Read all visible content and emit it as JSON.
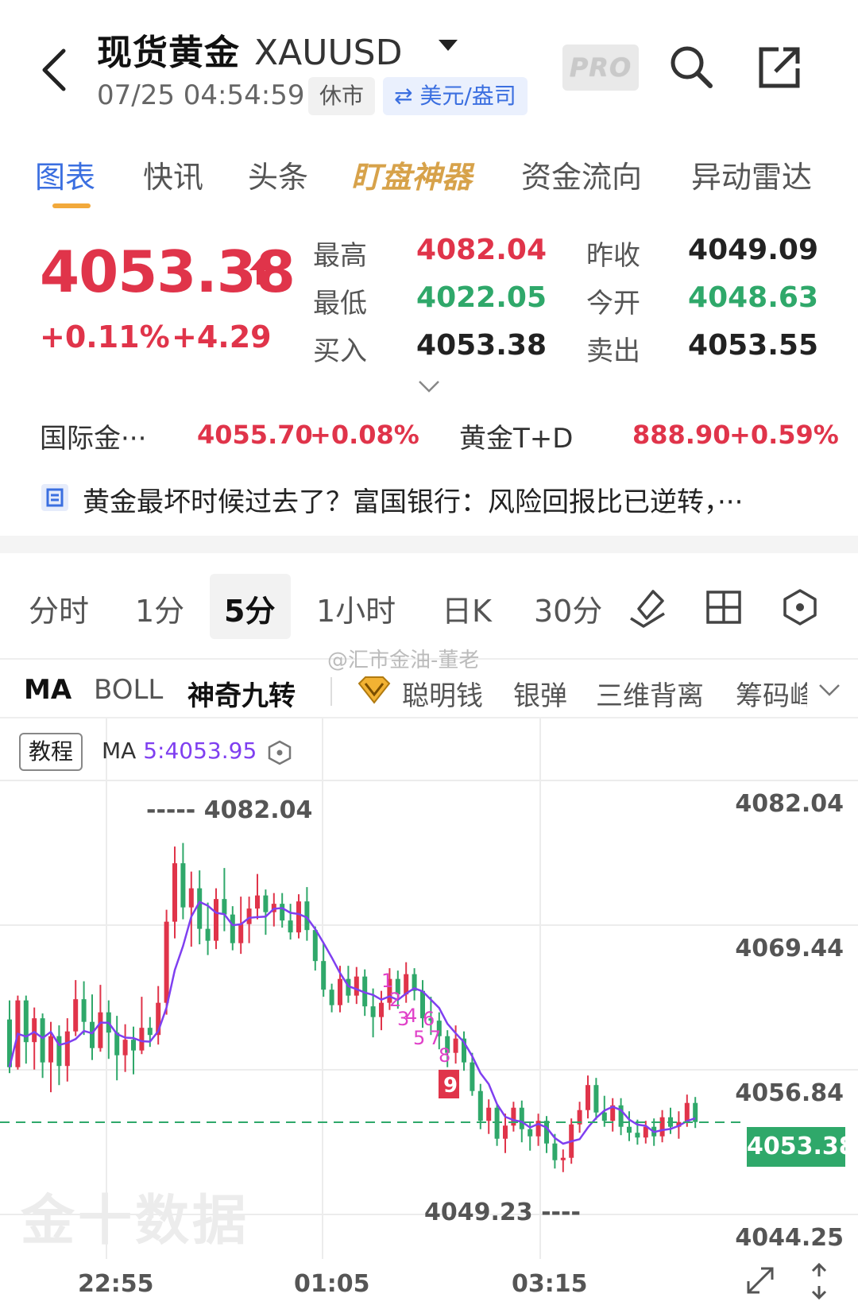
{
  "header": {
    "title": "现货黄金",
    "symbol": "XAUUSD",
    "datetime": "07/25 04:54:59",
    "market_status": "休市",
    "currency": "⇄ 美元/盎司",
    "pro_label": "PRO"
  },
  "tabs": [
    "图表",
    "快讯",
    "头条",
    "盯盘神器",
    "资金流向",
    "异动雷达"
  ],
  "quote": {
    "price": "4053.38",
    "change_pct": "+0.11%",
    "change_abs": "+4.29",
    "stats": [
      {
        "label": "最高",
        "value": "4082.04",
        "color": "red"
      },
      {
        "label": "昨收",
        "value": "4049.09",
        "color": "dark"
      },
      {
        "label": "最低",
        "value": "4022.05",
        "color": "green"
      },
      {
        "label": "今开",
        "value": "4048.63",
        "color": "green"
      },
      {
        "label": "买入",
        "value": "4053.38",
        "color": "dark"
      },
      {
        "label": "卖出",
        "value": "4053.55",
        "color": "dark"
      }
    ]
  },
  "related": [
    {
      "label": "国际金···",
      "price": "4055.70",
      "change": "+0.08%"
    },
    {
      "label": "黄金T+D",
      "price": "888.90",
      "change": "+0.59%"
    }
  ],
  "news": {
    "text": "黄金最坏时候过去了？富国银行：风险回报比已逆转，···"
  },
  "periods": [
    "分时",
    "1分",
    "5分",
    "1小时",
    "日K",
    "30分"
  ],
  "active_period": "5分",
  "indicators": {
    "main": [
      "MA",
      "BOLL",
      "神奇九转"
    ],
    "extra": [
      "聪明钱",
      "银弹",
      "三维背离",
      "筹码峰"
    ]
  },
  "watermark": "@汇市金油-董老",
  "chart": {
    "tutorial_label": "教程",
    "ma_prefix": "MA ",
    "ma_value": "5:4053.95",
    "last_price": "4053.38",
    "high_label": "4082.04",
    "low_label": "4049.23",
    "brand": "金十数据"
  },
  "chart_data": {
    "type": "candlestick",
    "title": "",
    "y_ticks": [
      "4082.04",
      "4069.44",
      "4056.84",
      "4044.25"
    ],
    "ylim": [
      4044.25,
      4082.04
    ],
    "x_ticks": [
      "22:55",
      "01:05",
      "03:15"
    ],
    "high": 4082.04,
    "low": 4049.23,
    "last": 4053.38,
    "ma5": 4053.95,
    "td_sequential_labels": [
      "1",
      "2",
      "3",
      "4",
      "6",
      "5",
      "7",
      "8",
      "9"
    ],
    "colors": {
      "up": "#e0344a",
      "down": "#2fa86a",
      "ma": "#7f3ff0",
      "td": "#e040c8"
    },
    "candles": [
      [
        4062.0,
        4063.6,
        4057.5,
        4058.0
      ],
      [
        4058.0,
        4064.0,
        4057.8,
        4063.6
      ],
      [
        4063.6,
        4064.0,
        4058.3,
        4060.1
      ],
      [
        4060.1,
        4063.0,
        4057.8,
        4062.1
      ],
      [
        4062.1,
        4062.5,
        4057.1,
        4058.4
      ],
      [
        4058.4,
        4061.8,
        4055.9,
        4060.6
      ],
      [
        4060.6,
        4061.5,
        4056.5,
        4058.1
      ],
      [
        4058.1,
        4062.1,
        4056.8,
        4061.0
      ],
      [
        4061.0,
        4065.3,
        4060.6,
        4063.7
      ],
      [
        4063.7,
        4065.2,
        4060.7,
        4061.8
      ],
      [
        4061.8,
        4064.1,
        4058.6,
        4059.6
      ],
      [
        4059.6,
        4064.9,
        4059.3,
        4062.6
      ],
      [
        4062.6,
        4063.6,
        4058.7,
        4060.9
      ],
      [
        4060.9,
        4062.3,
        4056.9,
        4059.0
      ],
      [
        4059.0,
        4061.6,
        4057.6,
        4060.3
      ],
      [
        4060.3,
        4061.4,
        4057.4,
        4059.4
      ],
      [
        4059.4,
        4063.9,
        4059.1,
        4061.3
      ],
      [
        4061.3,
        4062.2,
        4059.7,
        4060.7
      ],
      [
        4060.7,
        4064.8,
        4059.9,
        4063.4
      ],
      [
        4063.4,
        4071.2,
        4062.4,
        4070.2
      ],
      [
        4070.2,
        4076.5,
        4068.8,
        4075.1
      ],
      [
        4075.1,
        4076.8,
        4070.4,
        4071.4
      ],
      [
        4071.4,
        4074.4,
        4068.1,
        4073.0
      ],
      [
        4073.0,
        4074.5,
        4068.3,
        4069.6
      ],
      [
        4069.6,
        4071.8,
        4067.4,
        4068.6
      ],
      [
        4068.6,
        4073.0,
        4067.9,
        4072.1
      ],
      [
        4072.1,
        4074.7,
        4069.4,
        4070.8
      ],
      [
        4070.8,
        4071.5,
        4067.8,
        4068.4
      ],
      [
        4068.4,
        4072.3,
        4067.5,
        4070.0
      ],
      [
        4070.0,
        4072.3,
        4068.4,
        4071.3
      ],
      [
        4071.3,
        4074.2,
        4070.4,
        4072.4
      ],
      [
        4072.4,
        4072.9,
        4069.1,
        4071.0
      ],
      [
        4071.0,
        4072.6,
        4069.8,
        4071.7
      ],
      [
        4071.7,
        4072.6,
        4069.7,
        4070.3
      ],
      [
        4070.3,
        4071.7,
        4068.7,
        4069.3
      ],
      [
        4069.3,
        4072.5,
        4068.8,
        4071.9
      ],
      [
        4071.9,
        4073.1,
        4068.6,
        4069.5
      ],
      [
        4069.5,
        4069.8,
        4066.1,
        4066.9
      ],
      [
        4066.9,
        4068.4,
        4063.9,
        4064.5
      ],
      [
        4064.5,
        4065.0,
        4062.6,
        4063.2
      ],
      [
        4063.2,
        4066.5,
        4062.6,
        4065.4
      ],
      [
        4065.4,
        4066.5,
        4063.4,
        4064.0
      ],
      [
        4064.0,
        4066.4,
        4063.3,
        4065.6
      ],
      [
        4065.6,
        4066.2,
        4062.3,
        4063.1
      ],
      [
        4063.1,
        4064.6,
        4060.5,
        4062.2
      ],
      [
        4062.2,
        4064.4,
        4061.1,
        4063.4
      ],
      [
        4063.4,
        4066.3,
        4062.8,
        4065.4
      ],
      [
        4065.4,
        4066.1,
        4062.9,
        4064.1
      ],
      [
        4064.1,
        4066.8,
        4063.4,
        4065.8
      ],
      [
        4065.8,
        4066.3,
        4063.6,
        4064.4
      ],
      [
        4064.4,
        4065.3,
        4061.3,
        4062.1
      ],
      [
        4062.1,
        4063.9,
        4060.7,
        4061.9
      ],
      [
        4061.9,
        4062.6,
        4059.5,
        4060.6
      ],
      [
        4060.6,
        4061.1,
        4058.0,
        4059.2
      ],
      [
        4059.2,
        4061.5,
        4058.3,
        4060.4
      ],
      [
        4060.4,
        4061.0,
        4057.7,
        4058.4
      ],
      [
        4058.4,
        4059.2,
        4055.6,
        4056.0
      ],
      [
        4056.0,
        4056.6,
        4052.8,
        4053.5
      ],
      [
        4053.5,
        4055.3,
        4052.4,
        4054.6
      ],
      [
        4054.6,
        4054.9,
        4051.4,
        4052.0
      ],
      [
        4052.0,
        4054.1,
        4050.8,
        4053.1
      ],
      [
        4053.1,
        4055.1,
        4052.6,
        4054.6
      ],
      [
        4054.6,
        4055.2,
        4051.7,
        4052.8
      ],
      [
        4052.8,
        4053.4,
        4051.0,
        4052.2
      ],
      [
        4052.2,
        4054.1,
        4051.4,
        4053.5
      ],
      [
        4053.5,
        4053.9,
        4050.8,
        4051.6
      ],
      [
        4051.6,
        4052.4,
        4049.5,
        4050.2
      ],
      [
        4050.2,
        4051.1,
        4049.2,
        4050.4
      ],
      [
        4050.4,
        4053.7,
        4049.9,
        4053.2
      ],
      [
        4053.2,
        4055.1,
        4052.5,
        4054.4
      ],
      [
        4054.4,
        4057.3,
        4053.7,
        4056.5
      ],
      [
        4056.5,
        4057.1,
        4053.6,
        4054.2
      ],
      [
        4054.2,
        4055.6,
        4053.0,
        4053.5
      ],
      [
        4053.5,
        4055.4,
        4052.6,
        4054.8
      ],
      [
        4054.8,
        4055.4,
        4052.3,
        4053.0
      ],
      [
        4053.0,
        4054.3,
        4051.8,
        4052.5
      ],
      [
        4052.5,
        4053.6,
        4051.5,
        4052.1
      ],
      [
        4052.1,
        4053.5,
        4051.6,
        4053.0
      ],
      [
        4053.0,
        4053.7,
        4051.4,
        4052.2
      ],
      [
        4052.2,
        4054.4,
        4051.7,
        4053.8
      ],
      [
        4053.8,
        4054.6,
        4052.4,
        4053.0
      ],
      [
        4053.0,
        4054.3,
        4052.0,
        4053.4
      ],
      [
        4053.4,
        4055.7,
        4053.0,
        4055.0
      ],
      [
        4055.0,
        4055.5,
        4052.9,
        4053.4
      ]
    ]
  }
}
